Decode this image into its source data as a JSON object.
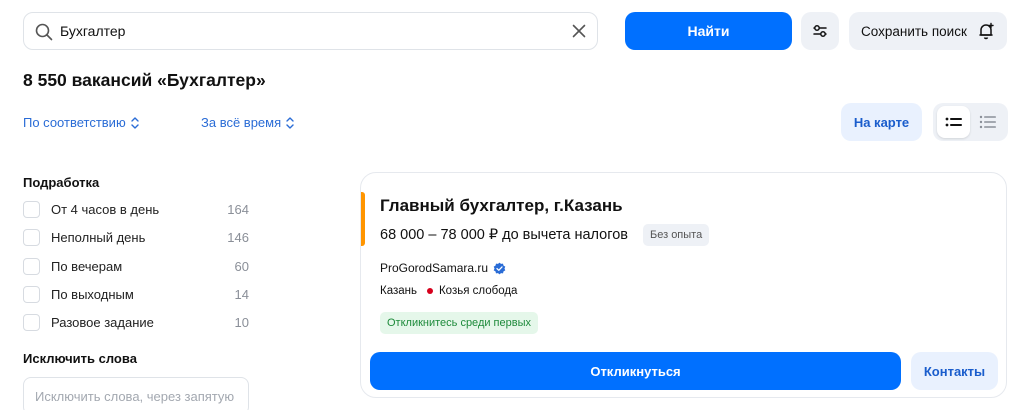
{
  "search": {
    "value": "Бухгалтер",
    "find_label": "Найти",
    "save_label": "Сохранить поиск"
  },
  "results": {
    "title": "8 550 вакансий «Бухгалтер»",
    "sort_label": "По соответствию",
    "period_label": "За всё время",
    "map_label": "На карте"
  },
  "filters": {
    "parttime_heading": "Подработка",
    "items": [
      {
        "label": "От 4 часов в день",
        "count": "164"
      },
      {
        "label": "Неполный день",
        "count": "146"
      },
      {
        "label": "По вечерам",
        "count": "60"
      },
      {
        "label": "По выходным",
        "count": "14"
      },
      {
        "label": "Разовое задание",
        "count": "10"
      }
    ],
    "exclude_heading": "Исключить слова",
    "exclude_placeholder": "Исключить слова, через запятую"
  },
  "vacancy": {
    "title": "Главный бухгалтер, г.Казань",
    "salary": "68 000 – 78 000 ₽ до вычета налогов",
    "experience": "Без опыта",
    "company": "ProGorodSamara.ru",
    "city": "Казань",
    "metro": "Козья слобода",
    "badge": "Откликнитесь среди первых",
    "apply_label": "Откликнуться",
    "contacts_label": "Контакты"
  },
  "colors": {
    "primary": "#0070ff",
    "accent_bar": "#ff9500",
    "metro_dot": "#d6001c",
    "badge_green": "#1d8a3a"
  }
}
